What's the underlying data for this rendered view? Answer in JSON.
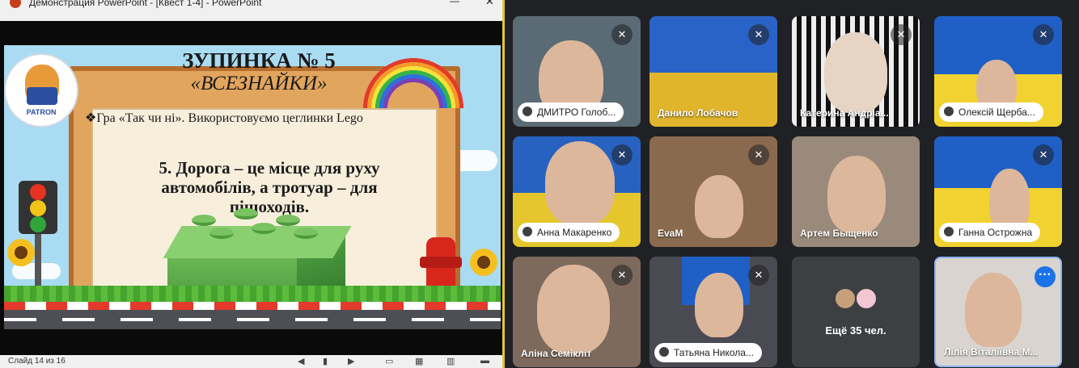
{
  "window": {
    "title": "Демонстрация PowerPoint - [Квест 1-4] - PowerPoint",
    "minimize_icon": "—",
    "close_icon": "✕"
  },
  "slide": {
    "title_line1": "ЗУПИНКА № 5",
    "title_line2": "«ВСЕЗНАЙКИ»",
    "bullet": "❖Гра «Так чи ні». Використовуємо цеглинки Lego",
    "statement": "5. Дорога – це місце для руху автомобілів, а тротуар – для пішоходів.",
    "logo_text": "PATRON"
  },
  "status_bar": {
    "slide_count": "Слайд 14 из 16",
    "controls": [
      "◀",
      "▮",
      "▶",
      "▭",
      "▦",
      "▥",
      "▬"
    ]
  },
  "participants": [
    {
      "name": "ДМИТРО Голоб...",
      "muted": true,
      "style": "pill"
    },
    {
      "name": "Данило Лобачов",
      "muted": true,
      "style": "plain"
    },
    {
      "name": "Катерина Андріа...",
      "muted": true,
      "style": "plain"
    },
    {
      "name": "Олексій Щерба...",
      "muted": true,
      "style": "pill"
    },
    {
      "name": "Анна Макаренко",
      "muted": true,
      "style": "pill"
    },
    {
      "name": "EvaM",
      "muted": true,
      "style": "plain"
    },
    {
      "name": "Артем Быщенко",
      "muted": false,
      "style": "plain"
    },
    {
      "name": "Ганна Острожна",
      "muted": true,
      "style": "pill"
    },
    {
      "name": "Аліна Семікліт",
      "muted": true,
      "style": "plain"
    },
    {
      "name": "Татьяна Никола...",
      "muted": true,
      "style": "pill"
    },
    {
      "name": "Лілія Віталіївна М...",
      "muted": false,
      "style": "plain",
      "active": true
    }
  ],
  "more_tile": {
    "label": "Ещё 35 чел."
  },
  "icons": {
    "mic_off": "mic-off-icon",
    "more": "more-options-icon"
  },
  "colors": {
    "call_bg": "#202124",
    "tile_bg": "#3c4043",
    "active_border": "#8ab4f8",
    "more_button": "#1a73e8",
    "ppt_border": "#e8c23a"
  }
}
